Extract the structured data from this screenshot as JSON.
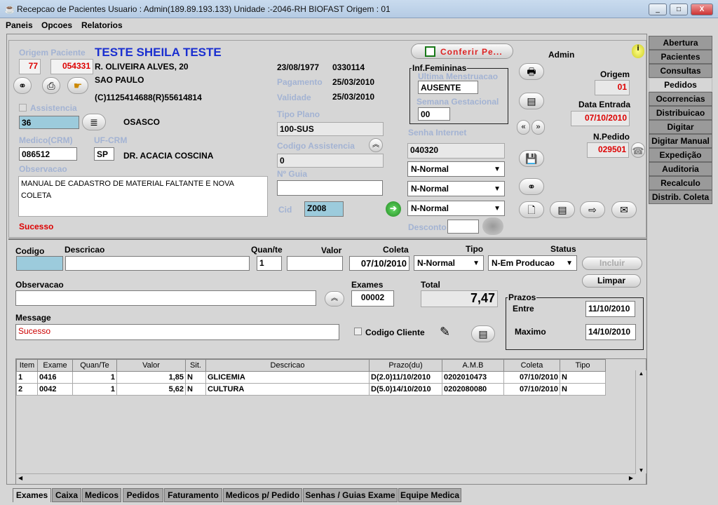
{
  "window": {
    "title": "Recepcao de Pacientes Usuario : Admin(189.89.193.133)  Unidade :-2046-RH BIOFAST Origem : 01",
    "minimize": "_",
    "maximize": "□",
    "close": "X"
  },
  "menu": [
    "Paneis",
    "Opcoes",
    "Relatorios"
  ],
  "patient": {
    "origem_label": "Origem Paciente",
    "name": "TESTE SHEILA TESTE",
    "origem1": "77",
    "origem2": "054331",
    "address": "R. OLIVEIRA ALVES, 20",
    "city": "SAO PAULO",
    "phone": "(C)1125414688(R)55614814",
    "assistencia_label": "Assistencia",
    "assistencia_code": "36",
    "assistencia_city": "OSASCO",
    "medico_label": "Medico(CRM)",
    "ufcrm_label": "UF-CRM",
    "crm": "086512",
    "uf": "SP",
    "doctor": "DR. ACACIA COSCINA",
    "obs_label": "Observacao",
    "obs": "MANUAL DE CADASTRO DE MATERIAL FALTANTE E NOVA COLETA",
    "status": "Sucesso"
  },
  "plan": {
    "birth": "23/08/1977",
    "code": "0330114",
    "pagamento_label": "Pagamento",
    "pagamento": "25/03/2010",
    "validade_label": "Validade",
    "validade": "25/03/2010",
    "tipo_plano_label": "Tipo Plano",
    "tipo_plano": "100-SUS",
    "cod_assist_label": "Codigo Assistencia",
    "cod_assist": "0",
    "guia_label": "Nº Guia",
    "guia": "",
    "cid_label": "Cid",
    "cid": "Z008"
  },
  "fem": {
    "conferir": "Conferir Pe...",
    "title": "Inf.Femininas",
    "ultima_label": "Ultima Menstruacao",
    "ultima": "AUSENTE",
    "semana_label": "Semana Gestacional",
    "semana": "00",
    "senha_label": "Senha Internet",
    "senha": "040320",
    "selects": [
      "N-Normal",
      "N-Normal",
      "N-Normal"
    ],
    "desconto_label": "Desconto",
    "desconto": ""
  },
  "order": {
    "user": "Admin",
    "origem_label": "Origem",
    "origem": "01",
    "data_label": "Data Entrada",
    "data": "07/10/2010",
    "npedido_label": "N.Pedido",
    "npedido": "029501"
  },
  "right_tabs": [
    "Abertura",
    "Pacientes",
    "Consultas",
    "Pedidos",
    "Ocorrencias",
    "Distribuicao",
    "Digitar",
    "Digitar Manual",
    "Expedição",
    "Auditoria",
    "Recalculo",
    "Distrib. Coleta"
  ],
  "active_right_tab": "Pedidos",
  "item": {
    "codigo_label": "Codigo",
    "codigo": "",
    "descricao_label": "Descricao",
    "descricao": "",
    "quant_label": "Quan/te",
    "quant": "1",
    "valor_label": "Valor",
    "valor": "",
    "coleta_label": "Coleta",
    "coleta": "07/10/2010",
    "tipo_label": "Tipo",
    "tipo": "N-Normal",
    "status_label": "Status",
    "status": "N-Em Producao",
    "incluir": "Incluir",
    "limpar": "Limpar",
    "obs_label": "Observacao",
    "obs": "",
    "exames_label": "Exames",
    "exames": "00002",
    "total_label": "Total",
    "total": "7,47",
    "message_label": "Message",
    "message": "Sucesso",
    "codcliente_label": "Codigo Cliente",
    "prazos_label": "Prazos",
    "entre_label": "Entre",
    "entre": "11/10/2010",
    "maximo_label": "Maximo",
    "maximo": "14/10/2010"
  },
  "table": {
    "headers": [
      "Item",
      "Exame",
      "Quan/Te",
      "Valor",
      "Sit.",
      "Descricao",
      "Prazo(du)",
      "A.M.B",
      "Coleta",
      "Tipo"
    ],
    "rows": [
      [
        "1",
        "0416",
        "1",
        "1,85",
        "N",
        "GLICEMIA",
        "D(2.0)11/10/2010",
        "0202010473",
        "07/10/2010",
        "N"
      ],
      [
        "2",
        "0042",
        "1",
        "5,62",
        "N",
        "CULTURA",
        "D(5.0)14/10/2010",
        "0202080080",
        "07/10/2010",
        "N"
      ]
    ]
  },
  "bottom_tabs": [
    "Exames",
    "Caixa",
    "Medicos",
    "Pedidos",
    "Faturamento",
    "Medicos p/ Pedido",
    "Senhas / Guias Exame",
    "Equipe Medica"
  ],
  "active_bottom_tab": "Exames"
}
